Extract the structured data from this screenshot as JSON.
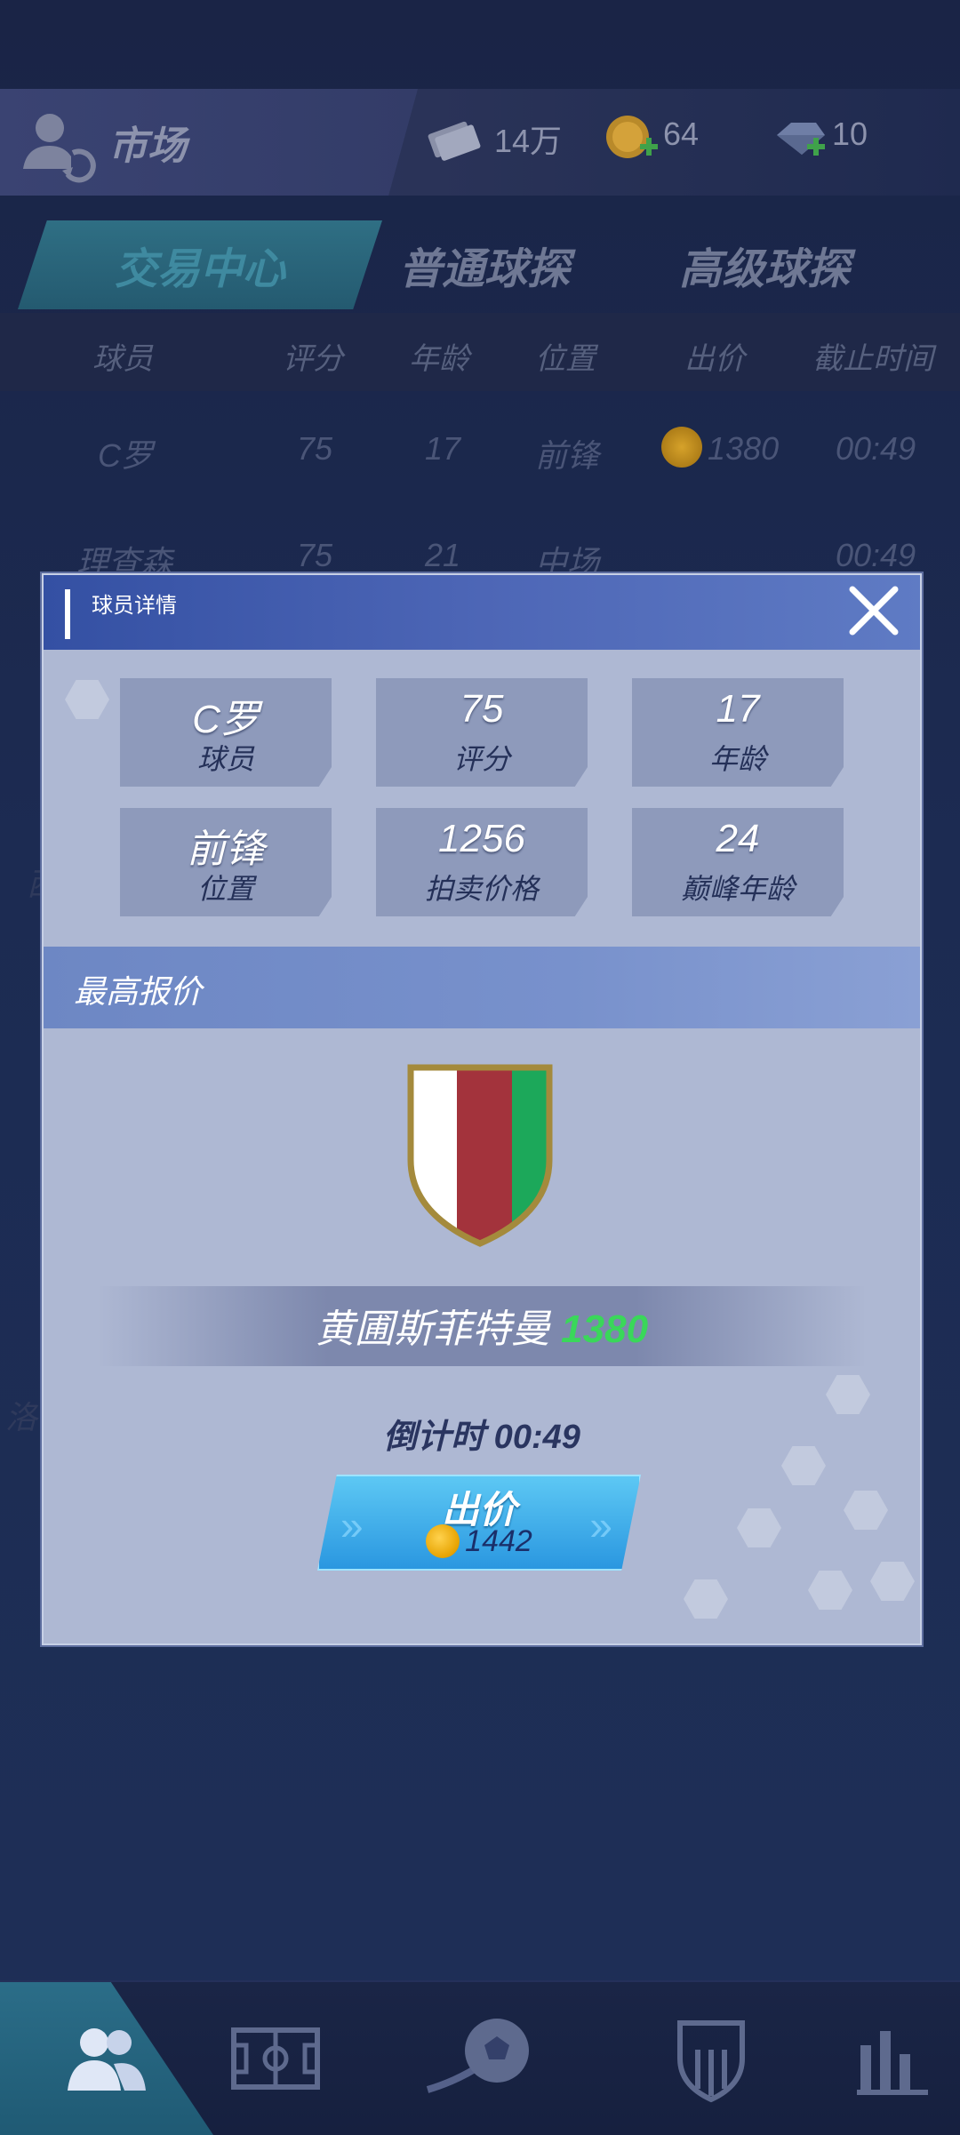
{
  "topbar": {
    "title": "市场",
    "resources": [
      {
        "icon": "cash-icon",
        "value": "14万"
      },
      {
        "icon": "gold-coin-icon",
        "value": "64"
      },
      {
        "icon": "diamond-icon",
        "value": "10"
      }
    ]
  },
  "tabs": [
    {
      "label": "交易中心",
      "active": true
    },
    {
      "label": "普通球探",
      "active": false
    },
    {
      "label": "高级球探",
      "active": false
    }
  ],
  "table": {
    "headers": [
      "球员",
      "评分",
      "年龄",
      "位置",
      "出价",
      "截止时间"
    ],
    "rows": [
      {
        "player": "C罗",
        "rating": "75",
        "age": "17",
        "position": "前锋",
        "bid": "1380",
        "deadline": "00:49"
      },
      {
        "player": "理查森",
        "rating": "75",
        "age": "21",
        "position": "中场",
        "bid": "",
        "deadline": "00:49"
      }
    ],
    "partial_left": [
      "西",
      "洛佩"
    ]
  },
  "dialog": {
    "title": "球员详情",
    "stats": [
      {
        "value": "C罗",
        "label": "球员"
      },
      {
        "value": "75",
        "label": "评分"
      },
      {
        "value": "17",
        "label": "年龄"
      },
      {
        "value": "前锋",
        "label": "位置"
      },
      {
        "value": "1256",
        "label": "拍卖价格"
      },
      {
        "value": "24",
        "label": "巅峰年龄"
      }
    ],
    "section_title": "最高报价",
    "crest_colors": [
      "#ffffff",
      "#a3333c",
      "#1ca85a"
    ],
    "top_bidder": "黄圃斯菲特曼",
    "top_bid": "1380",
    "countdown": "倒计时 00:49",
    "bid_button": {
      "label": "出价",
      "price": "1442"
    }
  },
  "bottom_nav": [
    {
      "icon": "players-icon",
      "active": true
    },
    {
      "icon": "pitch-icon",
      "active": false
    },
    {
      "icon": "football-icon",
      "active": false
    },
    {
      "icon": "club-badge-icon",
      "active": false
    },
    {
      "icon": "stats-icon",
      "active": false
    }
  ],
  "colors": {
    "accent": "#2a97e0",
    "bid_price": "#3ad75a",
    "dialog_bg": "#aeb8d3",
    "header_bg": "#3450a3"
  }
}
